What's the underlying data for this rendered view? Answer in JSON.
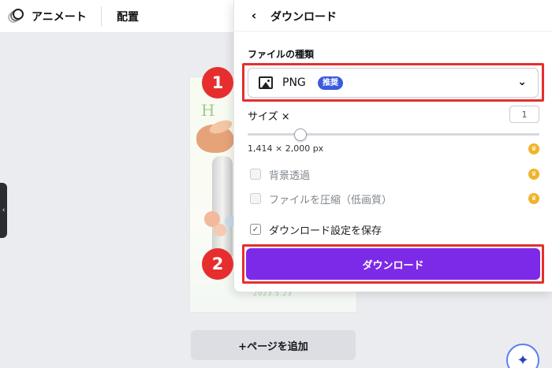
{
  "toolbar": {
    "animate_label": "アニメート",
    "position_label": "配置"
  },
  "canvas": {
    "heading_letter": "H",
    "date_text": "2023.5.23",
    "add_page_label": "+ページを追加"
  },
  "panel": {
    "back_icon": "chevron-left-icon",
    "title": "ダウンロード",
    "file_type_label": "ファイルの種類",
    "file_type_value": "PNG",
    "file_type_badge": "推奨",
    "size_label": "サイズ ×",
    "size_value": "1",
    "size_slider_value": 0.18,
    "dimensions": "1,414 × 2,000 px",
    "options": [
      {
        "label": "背景透過",
        "checked": false,
        "pro": true
      },
      {
        "label": "ファイルを圧縮（低画質）",
        "checked": false,
        "pro": true
      },
      {
        "label": "ダウンロード設定を保存",
        "checked": true,
        "pro": false
      }
    ],
    "download_button": "ダウンロード"
  },
  "callouts": {
    "step1": "1",
    "step2": "2",
    "color": "#e62e2e"
  },
  "colors": {
    "accent_purple": "#7d2ae8",
    "badge_blue": "#3b5ae0",
    "crown_gold": "#f0b429"
  }
}
